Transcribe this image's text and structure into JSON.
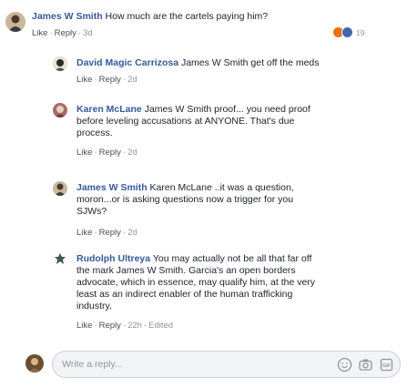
{
  "comments": [
    {
      "author": "James W Smith",
      "body": "How much are the cartels paying him?",
      "actions": {
        "like": "Like",
        "reply": "Reply",
        "time": "3d"
      },
      "reactions": {
        "icons": [
          "angry-icon",
          "like-icon"
        ],
        "count": "19"
      }
    }
  ],
  "replies": [
    {
      "author": "David Magic Carrizosa",
      "body": "James W Smith get off the meds",
      "actions": {
        "like": "Like",
        "reply": "Reply",
        "time": "2d"
      }
    },
    {
      "author": "Karen McLane",
      "lines": [
        "James W Smith proof... you need proof",
        "before leveling accusations at ANYONE. That's due",
        "process."
      ],
      "actions": {
        "like": "Like",
        "reply": "Reply",
        "time": "2d"
      }
    },
    {
      "author": "James W Smith",
      "lines": [
        "Karen McLane ..it was a question,",
        "moron...or is asking questions now a trigger for you",
        "SJWs?"
      ],
      "actions": {
        "like": "Like",
        "reply": "Reply",
        "time": "2d"
      }
    },
    {
      "author": "Rudolph Ultreya",
      "lines": [
        "You may actually not be all that far off",
        "the mark James W Smith. Garcia's an open borders",
        "advocate, which in essence, may qualify him, at the very",
        "least as an indirect enabler of the human trafficking",
        "industry."
      ],
      "actions": {
        "like": "Like",
        "reply": "Reply",
        "time": "22h",
        "edited": "Edited"
      }
    }
  ],
  "reply_box": {
    "placeholder": "Write a reply...",
    "icons": [
      "emoji-icon",
      "camera-icon",
      "gif-icon"
    ]
  },
  "colors": {
    "link": "#365899",
    "meta": "#90949c",
    "text": "#1d2129",
    "angry": "#e9710f",
    "like": "#4267b2"
  }
}
